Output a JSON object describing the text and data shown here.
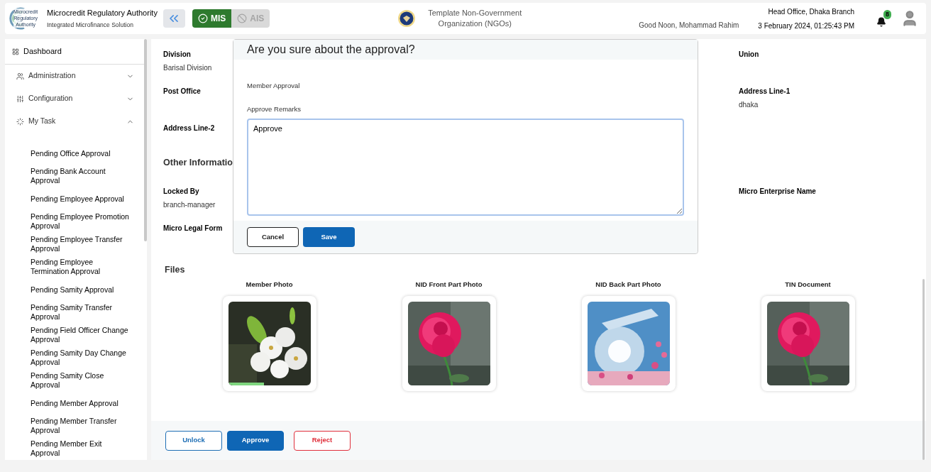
{
  "header": {
    "org_name": "Microcredit Regulatory Authority",
    "org_subtitle": "Integrated Microfinance Solution",
    "logo_text": [
      "Microcredit",
      "Regulatory",
      "Authority"
    ],
    "modules": [
      {
        "label": "MIS",
        "selected": true
      },
      {
        "label": "AIS",
        "selected": false
      }
    ],
    "center_org": "Template Non-Government Organization (NGOs)",
    "greeting": "Good Noon, Mohammad Rahim",
    "branch": "Head Office, Dhaka Branch",
    "datetime": "3 February 2024, 01:25:43 PM",
    "notification_count": "8"
  },
  "sidebar": {
    "dashboard": "Dashboard",
    "menus": [
      {
        "label": "Administration",
        "expanded": false
      },
      {
        "label": "Configuration",
        "expanded": false
      },
      {
        "label": "My Task",
        "expanded": true,
        "children": [
          "Pending Office Approval",
          "Pending Bank Account Approval",
          "Pending Employee Approval",
          "Pending Employee Promotion Approval",
          "Pending Employee Transfer Approval",
          "Pending Employee Termination Approval",
          "Pending Samity Approval",
          "Pending Samity Transfer Approval",
          "Pending Field Officer Change Approval",
          "Pending Samity Day Change Approval",
          "Pending Samity Close Approval",
          "Pending Member Approval",
          "Pending Member Transfer Approval",
          "Pending Member Exit Approval"
        ]
      }
    ]
  },
  "address_rows": [
    {
      "left": {
        "label": "Division",
        "value": "Barisal Division"
      },
      "right": {
        "label": "Union"
      }
    },
    {
      "left": {
        "label": "Post Office"
      },
      "right": {
        "label": "Address Line-1",
        "value": "dhaka"
      }
    },
    {
      "left": {
        "label": "Address Line-2"
      }
    }
  ],
  "other_heading": "Other Informatio",
  "other_rows": [
    {
      "left": {
        "label": "Locked By",
        "value": "branch-manager"
      },
      "right": {
        "label": "Micro Enterprise Name"
      }
    },
    {
      "left": {
        "label": "Micro Legal Form"
      }
    }
  ],
  "files": {
    "heading": "Files",
    "items": [
      {
        "label": "Member Photo",
        "kind": "picture"
      },
      {
        "label": "NID Front Part Photo",
        "kind": "picture"
      },
      {
        "label": "NID Back Part Photo",
        "kind": "picture"
      },
      {
        "label": "TIN Document",
        "kind": "picture"
      }
    ]
  },
  "actions": [
    {
      "label": "Unlock",
      "kind": "outline"
    },
    {
      "label": "Approve",
      "kind": "primary"
    },
    {
      "label": "Reject",
      "kind": "danger"
    }
  ],
  "modal": {
    "title": "Are you sure about the approval?",
    "subject": "Member Approval",
    "remarks_label": "Approve Remarks",
    "remarks_value": "Approve",
    "buttons": [
      {
        "label": "Cancel",
        "kind": "outline"
      },
      {
        "label": "Save",
        "kind": "primary"
      }
    ]
  }
}
